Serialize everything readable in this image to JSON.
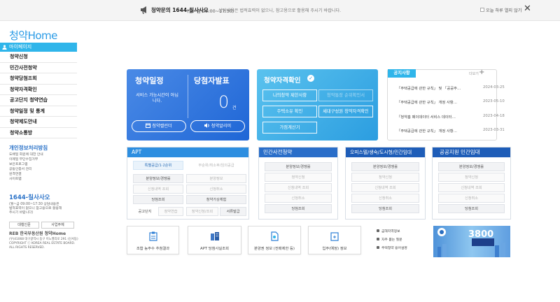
{
  "topbar": {
    "title": "청약문의 1644-칠사사오",
    "hours": "(월~금 09:00~17:30)",
    "notice": "상담내용은 법적효력이 없으니, 참고용으로 활용해 주시기 바랍니다.",
    "hide_today": "오늘 하루 열지 않기",
    "close": "✕"
  },
  "logo": "청약Home",
  "sidebar": {
    "mypage": "마이페이지",
    "items": [
      "청약신청",
      "민간사전청약",
      "청약당첨조회",
      "청약자격확인",
      "공고단지 청약연습",
      "청약일정 및 통계",
      "청약제도안내",
      "청약소통방"
    ],
    "privacy": "개인정보처리방침",
    "small": [
      "도배일 회원에 대한 안내",
      "이메일 무단수집거부",
      "보안프로그램",
      "공동인증서 관리",
      "원격연결",
      "사이트맵"
    ],
    "phone": "1644-칠사사오",
    "phone_sub": [
      "(월~금 09:00~17:30 상담내용은",
      "법적효력이 없으니 참고용으로 활용해",
      "주시기 바랍니다)"
    ],
    "btn_a": "대행인문",
    "btn_b": "사업주체",
    "footer_logo": "REB 한국부동산원 청약Home",
    "footer": [
      "(우)41068 대구광역시 동구 이노밸리로 291 (신서동)",
      "COPYRIGHT ⓒ KOREA REAL ESTATE BOARD.",
      "ALL RIGHTS RESERVED."
    ]
  },
  "schedule": {
    "title": "청약일정",
    "svc": "서비스 가능시간이 아닙니다.",
    "calendar_btn": "청약캘린더",
    "alert_btn": "청약알리미"
  },
  "winner": {
    "title": "당첨자발표",
    "count": "0",
    "unit": "건"
  },
  "qualify": {
    "title": "청약자격확인",
    "check": "✓",
    "buttons": [
      "나의청약 제한사항",
      "청약통장 순위확인서",
      "주택소유 확인",
      "세대구성원 청약자격확인",
      "가점계산기"
    ]
  },
  "notice": {
    "tab": "공지사항",
    "more": "더보기",
    "plus": "+",
    "items": [
      {
        "t": "「주택공급에 관한 규칙」 및 「공공주…",
        "d": "2024-03-25"
      },
      {
        "t": "「주택공급에 관한 규칙」 개정 사항…",
        "d": "2023-05-10"
      },
      {
        "t": "「청약홈 페이데이터 서비스 데이터…",
        "d": "2023-04-18"
      },
      {
        "t": "「주택공급에 관한 규칙」 개정 사항…",
        "d": "2023-03-31"
      }
    ]
  },
  "apt": {
    "title": "APT",
    "tab1": "특별공급/1·2순위",
    "tab2": "무순위/취소후/임의공급",
    "rows": [
      [
        "분양정보/경쟁률",
        "분양정보"
      ],
      [
        "신청내역 조회",
        "신청취소"
      ],
      [
        "당첨조회",
        "청약가상체험"
      ]
    ],
    "bottom": [
      "공고단지",
      "청약연습",
      "청약신청/조회",
      "서류발급"
    ]
  },
  "presale": {
    "title": "민간사전청약",
    "items": [
      "분양정보/경쟁률",
      "청약신청",
      "신청내역 조회",
      "신청취소",
      "당첨조회"
    ]
  },
  "officetel": {
    "title": "오피스텔/생숙/도시형/민간임대",
    "items": [
      "분양정보/경쟁률",
      "청약신청",
      "신청내역 조회",
      "신청취소",
      "당첨조회"
    ]
  },
  "public": {
    "title": "공공지원 민간임대",
    "items": [
      "분양정보/경쟁률",
      "청약신청",
      "신청내역 조회",
      "신청취소",
      "당첨조회"
    ]
  },
  "shortcuts": [
    "조합 농주수 추첨결과",
    "APT 당첨사실조회",
    "분양권 정보 (전매제한 등)",
    "입주(예정) 정보"
  ],
  "links": [
    "금해지역정보",
    "자주 묻는 질문",
    "주택청약 용어설명"
  ],
  "banner": {
    "number": "3800"
  },
  "colors": {
    "accent": "#2fb5ea",
    "blue": "#1f66d6",
    "apt": "#2d8ee0",
    "presale": "#2a6ec9",
    "officetel": "#1e5db8",
    "public": "#1e5db8"
  }
}
